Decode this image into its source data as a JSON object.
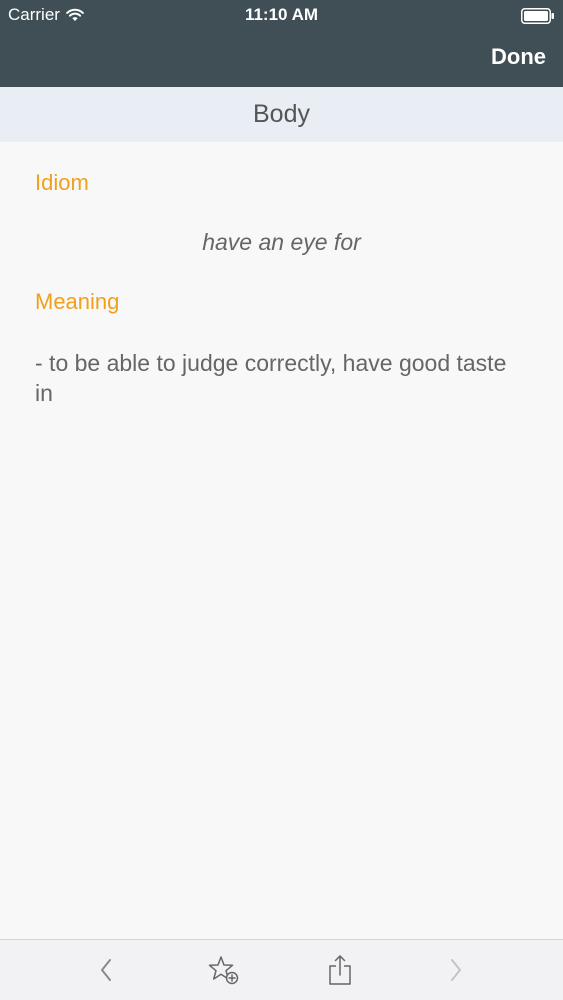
{
  "status_bar": {
    "carrier": "Carrier",
    "time": "11:10 AM"
  },
  "nav": {
    "done_label": "Done"
  },
  "section": {
    "title": "Body"
  },
  "content": {
    "idiom_label": "Idiom",
    "idiom_text": "have an eye for",
    "meaning_label": "Meaning",
    "meaning_text": "- to be able to judge correctly, have good taste in"
  },
  "toolbar": {
    "icons": [
      "chevron-left-icon",
      "star-add-icon",
      "share-icon",
      "chevron-right-icon"
    ]
  },
  "colors": {
    "nav_background": "#3f4f55",
    "accent": "#f0a01e",
    "section_background": "#e9eef5",
    "body_text": "#666666"
  }
}
